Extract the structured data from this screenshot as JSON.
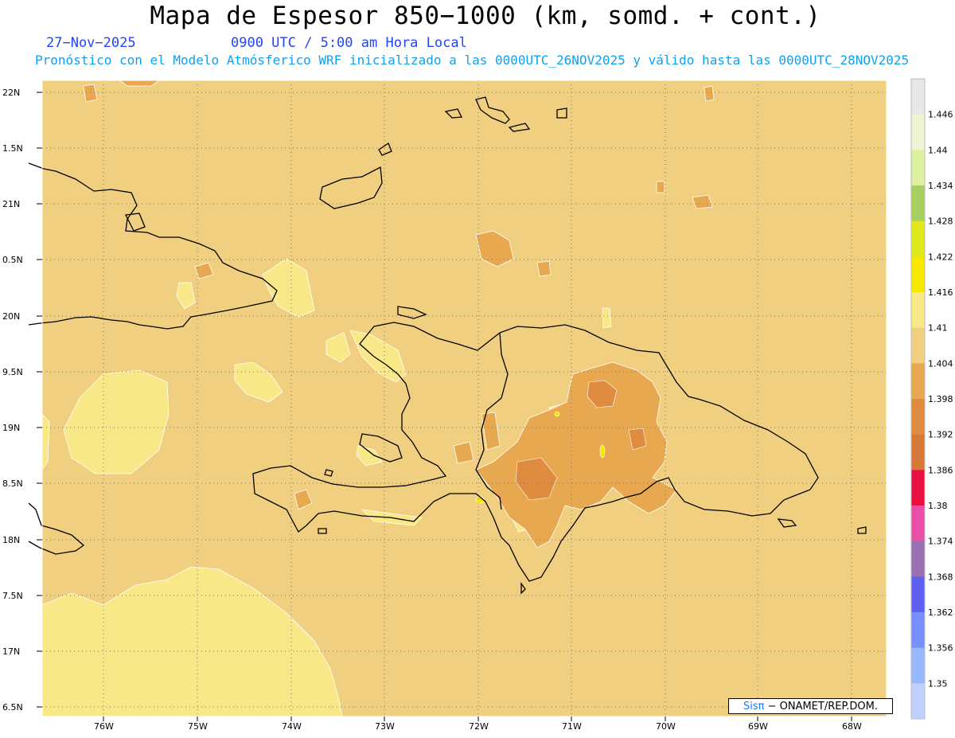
{
  "title": "Mapa de Espesor 850−1000 (km, somd. + cont.)",
  "date": "27−Nov−2025",
  "time": "0900 UTC / 5:00 am Hora Local",
  "subtitle": "Pronóstico con el Modelo Atmósferico WRF inicializado a las 0000UTC_26NOV2025 y válido hasta las  0000UTC_28NOV2025",
  "lat_labels": [
    "22N",
    "1.5N",
    "21N",
    "0.5N",
    "20N",
    "9.5N",
    "19N",
    "8.5N",
    "18N",
    "7.5N",
    "17N",
    "6.5N"
  ],
  "lon_labels": [
    "76W",
    "75W",
    "74W",
    "73W",
    "72W",
    "71W",
    "70W",
    "69W",
    "68W"
  ],
  "colorbar": {
    "labels": [
      "1.446",
      "1.44",
      "1.434",
      "1.428",
      "1.422",
      "1.416",
      "1.41",
      "1.404",
      "1.398",
      "1.392",
      "1.386",
      "1.38",
      "1.374",
      "1.368",
      "1.362",
      "1.356",
      "1.35"
    ],
    "colors": [
      "#e8e8e8",
      "#eef5d2",
      "#dcf0a0",
      "#a8d060",
      "#e0e820",
      "#f8e800",
      "#f8e888",
      "#f0d080",
      "#e8a850",
      "#e08c40",
      "#d87838",
      "#e81040",
      "#e850a8",
      "#9870b0",
      "#6060f0",
      "#7890ff",
      "#98b8ff",
      "#c0d0ff"
    ]
  },
  "field_colors": {
    "background": "#f0d080",
    "higher": "#f8e888",
    "lower": "#e8a850",
    "lowest": "#e08c40",
    "peak": "#f8e800"
  },
  "credit": {
    "brand": "Sisπ",
    "org": " − ONAMET/REP.DOM."
  }
}
